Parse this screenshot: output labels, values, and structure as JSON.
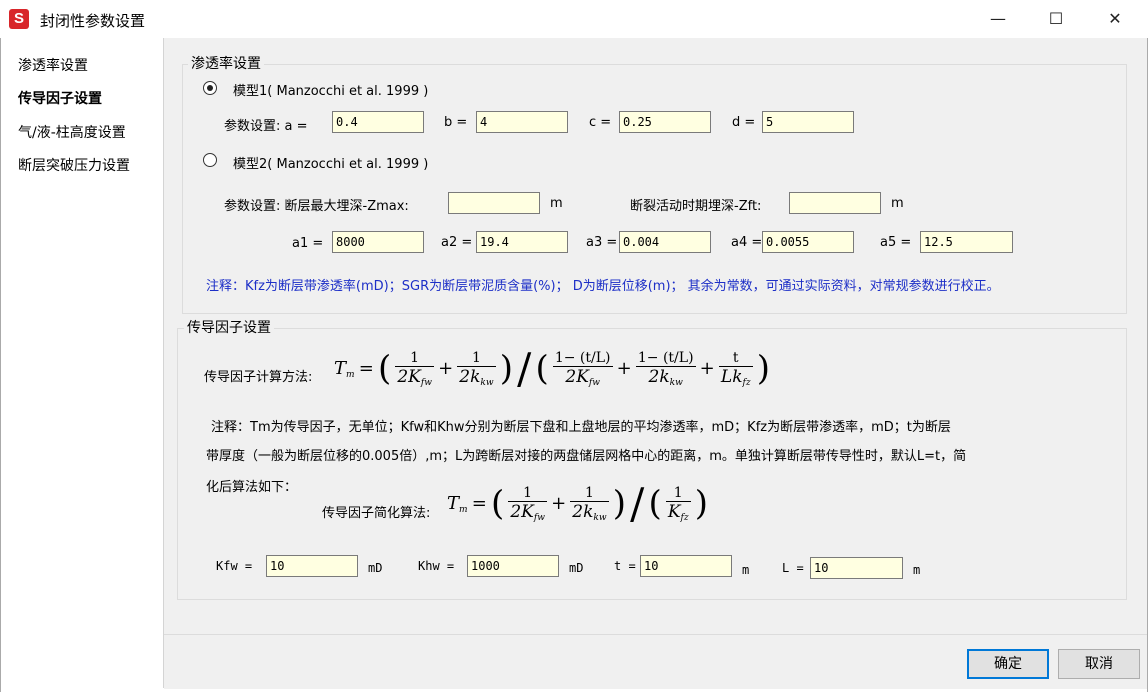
{
  "window": {
    "title": "封闭性参数设置",
    "icon_letter": "S",
    "minimize": "—",
    "maximize": "☐",
    "close": "✕"
  },
  "sidebar": {
    "items": [
      {
        "label": "渗透率设置",
        "active": false
      },
      {
        "label": "传导因子设置",
        "active": true
      },
      {
        "label": "气/液-柱高度设置",
        "active": false
      },
      {
        "label": "断层突破压力设置",
        "active": false
      }
    ]
  },
  "permeability": {
    "title": "渗透率设置",
    "model1": {
      "label": "模型1( Manzocchi et al. 1999 )",
      "selected": true,
      "params_label": "参数设置: a =",
      "a": "0.4",
      "b_label": "b =",
      "b": "4",
      "c_label": "c =",
      "c": "0.25",
      "d_label": "d =",
      "d": "5"
    },
    "model2": {
      "label": "模型2( Manzocchi et al. 1999 )",
      "selected": false,
      "params_label": "参数设置: 断层最大埋深-Zmax:",
      "zmax": "",
      "zmax_unit": "m",
      "zft_label": "断裂活动时期埋深-Zft:",
      "zft": "",
      "zft_unit": "m",
      "a1_label": "a1 =",
      "a1": "8000",
      "a2_label": "a2 =",
      "a2": "19.4",
      "a3_label": "a3 =",
      "a3": "0.004",
      "a4_label": "a4 =",
      "a4": "0.0055",
      "a5_label": "a5 =",
      "a5": "12.5"
    },
    "note": "注释：Kfz为断层带渗透率(mD)；SGR为断层带泥质含量(%)； D为断层位移(m)；  其余为常数，可通过实际资料，对常规参数进行校正。"
  },
  "transmissibility": {
    "title": "传导因子设置",
    "method_label": "传导因子计算方法:",
    "note_line1": "注释：Tm为传导因子，无单位；Kfw和Khw分别为断层下盘和上盘地层的平均渗透率，mD；Kfz为断层带渗透率，mD；t为断层",
    "note_line2": "带厚度（一般为断层位移的0.005倍）,m；L为跨断层对接的两盘储层网格中心的距离，m。单独计算断层带传导性时，默认L=t，简",
    "note_line3": "化后算法如下：",
    "simplified_label": "传导因子简化算法:",
    "kfw_label": "Kfw =",
    "kfw": "10",
    "kfw_unit": "mD",
    "khw_label": "Khw =",
    "khw": "1000",
    "khw_unit": "mD",
    "t_label": "t =",
    "t": "10",
    "t_unit": "m",
    "l_label": "L =",
    "l": "10",
    "l_unit": "m"
  },
  "formula": {
    "T": "T",
    "m": "m",
    "eq": "=",
    "one": "1",
    "plus": "+",
    "two_K": "2K",
    "two_k": "2k",
    "fw": "fw",
    "kw": "kw",
    "fz": "fz",
    "one_minus": "1− (t/L)",
    "t": "t",
    "Lk": "Lk",
    "K": "K",
    "lparen": "(",
    "rparen": ")",
    "slash": "/"
  },
  "buttons": {
    "ok": "确定",
    "cancel": "取消"
  }
}
